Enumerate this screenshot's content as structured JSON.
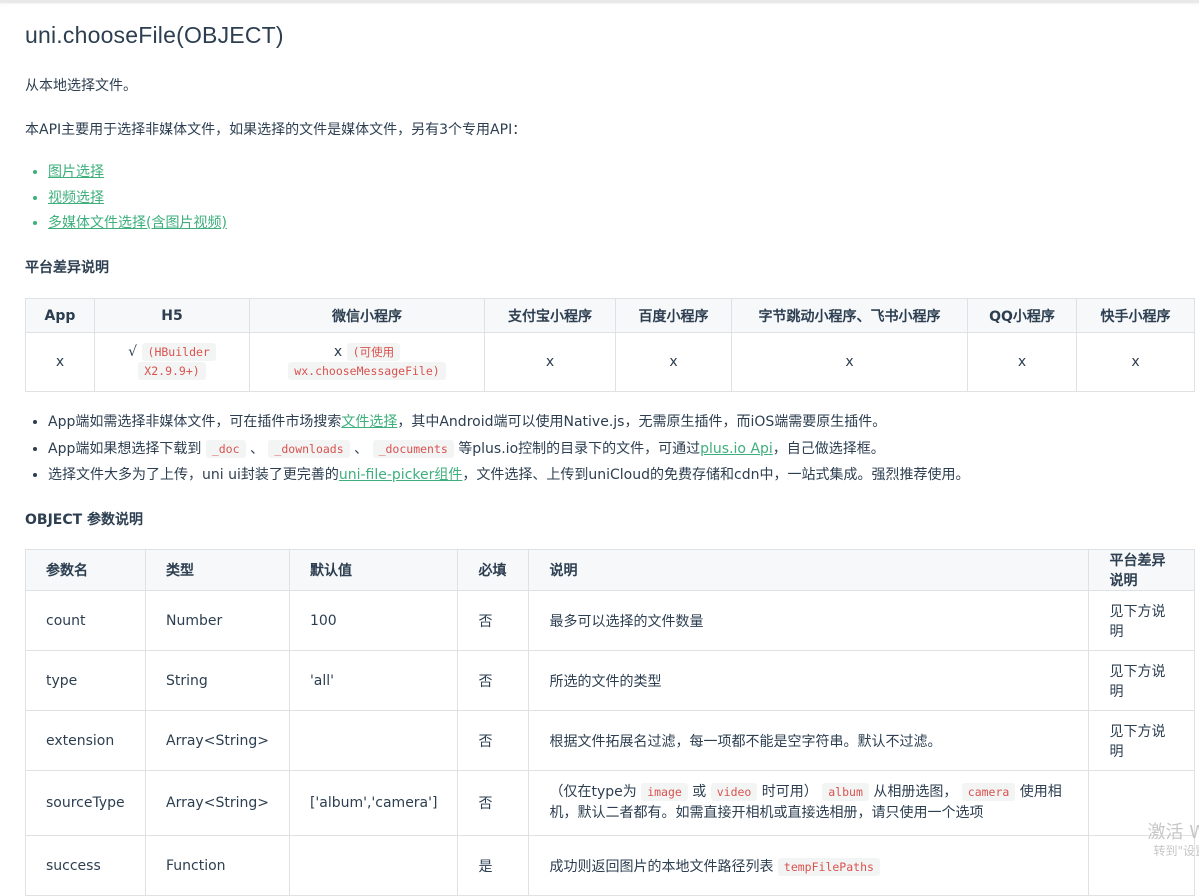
{
  "title": "uni.chooseFile(OBJECT)",
  "intro": "从本地选择文件。",
  "desc": "本API主要用于选择非媒体文件，如果选择的文件是媒体文件，另有3个专用API：",
  "links": [
    "图片选择",
    "视频选择",
    "多媒体文件选择(含图片视频)"
  ],
  "section_platform": "平台差异说明",
  "platform_table": {
    "headers": [
      "App",
      "H5",
      "微信小程序",
      "支付宝小程序",
      "百度小程序",
      "字节跳动小程序、飞书小程序",
      "QQ小程序",
      "快手小程序"
    ],
    "row": {
      "app": "x",
      "h5_mark": "√",
      "h5_code_1": "(HBuilder",
      "h5_code_2": "X2.9.9+)",
      "wx_mark": "x",
      "wx_code_1": "(可使用",
      "wx_code_2": "wx.chooseMessageFile)",
      "alipay": "x",
      "baidu": "x",
      "bytedance": "x",
      "qq": "x",
      "kuaishou": "x"
    }
  },
  "notes": {
    "n1_a": "App端如需选择非媒体文件，可在插件市场搜索",
    "n1_link": "文件选择",
    "n1_b": "，其中Android端可以使用Native.js，无需原生插件，而iOS端需要原生插件。",
    "n2_a": "App端如果想选择下载到",
    "n2_code1": "_doc",
    "n2_sep1": "、",
    "n2_code2": "_downloads",
    "n2_sep2": "、",
    "n2_code3": "_documents",
    "n2_b": "等plus.io控制的目录下的文件，可通过",
    "n2_link": "plus.io Api",
    "n2_c": "，自己做选择框。",
    "n3_a": "选择文件大多为了上传，uni ui封装了更完善的",
    "n3_link": "uni-file-picker组件",
    "n3_b": "，文件选择、上传到uniCloud的免费存储和cdn中，一站式集成。强烈推荐使用。"
  },
  "section_object": "OBJECT 参数说明",
  "param_table": {
    "headers": [
      "参数名",
      "类型",
      "默认值",
      "必填",
      "说明",
      "平台差异说明"
    ],
    "rows": [
      {
        "name": "count",
        "type": "Number",
        "default": "100",
        "required": "否",
        "desc": "最多可以选择的文件数量",
        "platform": "见下方说明"
      },
      {
        "name": "type",
        "type": "String",
        "default": "'all'",
        "required": "否",
        "desc": "所选的文件的类型",
        "platform": "见下方说明"
      },
      {
        "name": "extension",
        "type": "Array<String>",
        "default": "",
        "required": "否",
        "desc": "根据文件拓展名过滤，每一项都不能是空字符串。默认不过滤。",
        "platform": "见下方说明"
      },
      {
        "name": "sourceType",
        "type": "Array<String>",
        "default": "['album','camera']",
        "required": "否",
        "desc_a": "（仅在type为",
        "desc_code1": "image",
        "desc_b": "或",
        "desc_code2": "video",
        "desc_c": "时可用）",
        "desc_code3": "album",
        "desc_d": "从相册选图，",
        "desc_code4": "camera",
        "desc_e": "使用相机，默认二者都有。如需直接开相机或直接选相册，请只使用一个选项",
        "platform": ""
      },
      {
        "name": "success",
        "type": "Function",
        "default": "",
        "required": "是",
        "desc": "成功则返回图片的本地文件路径列表",
        "desc_code": "tempFilePaths",
        "platform": ""
      }
    ]
  },
  "watermark": "激活 W",
  "watermark2": "转到\"设置"
}
